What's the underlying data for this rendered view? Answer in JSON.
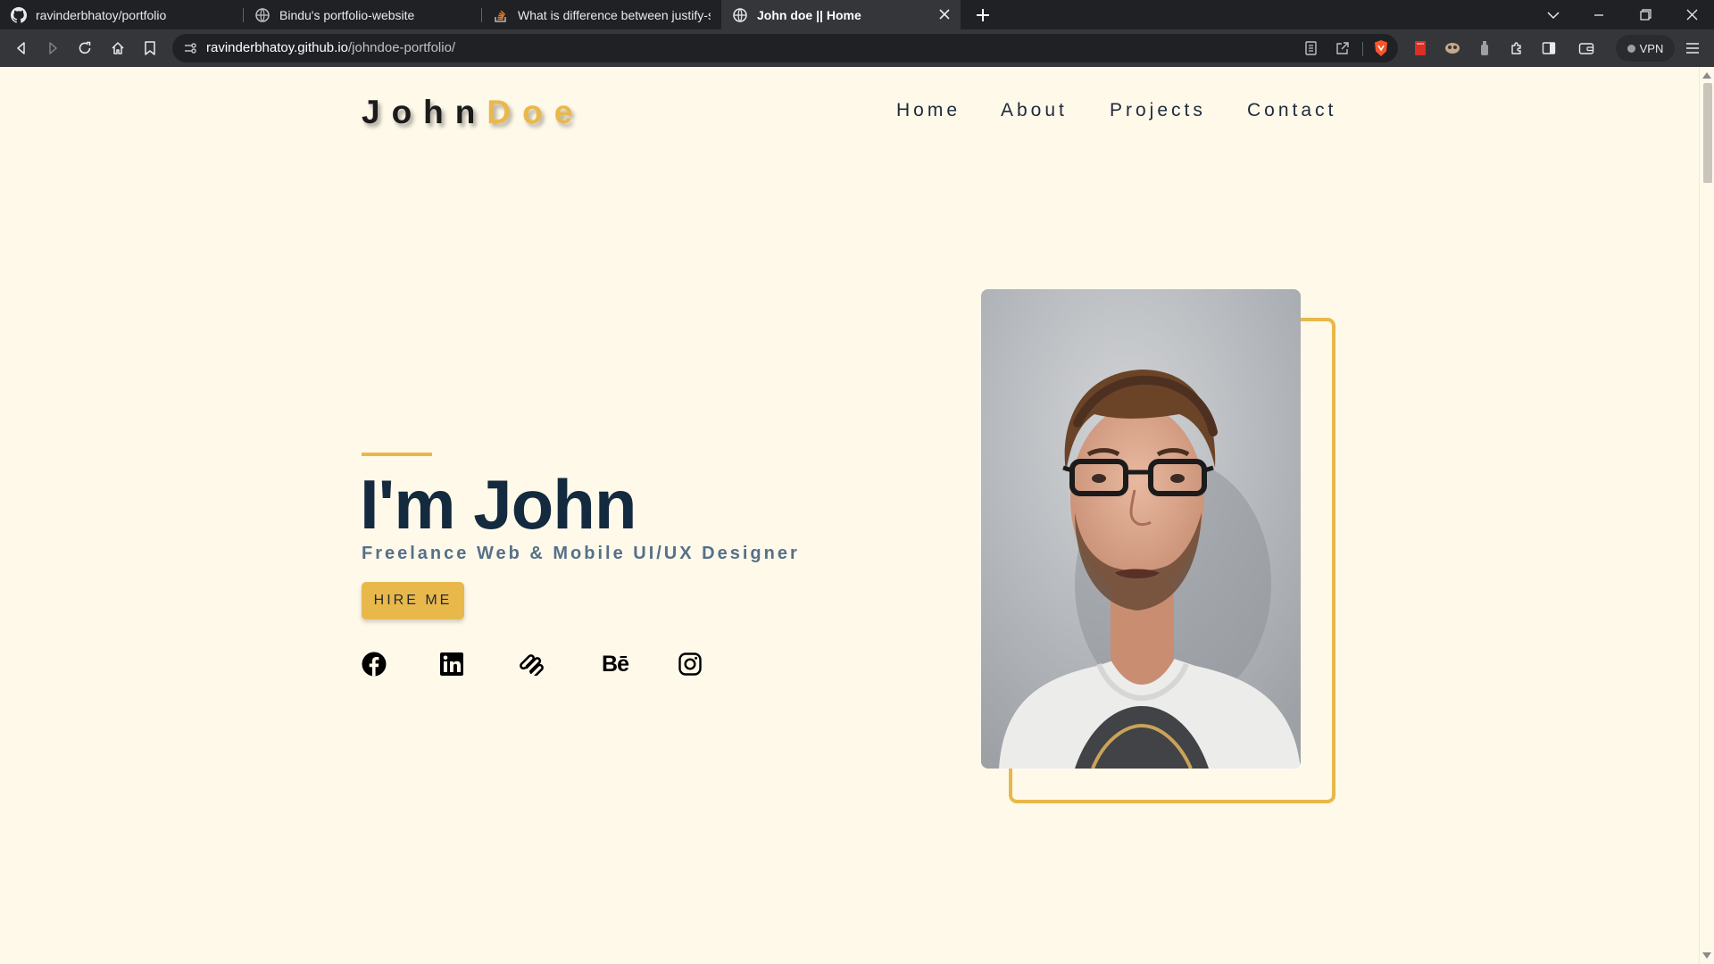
{
  "browser": {
    "tabs": [
      {
        "title": "ravinderbhatoy/portfolio",
        "icon": "github-icon",
        "active": false
      },
      {
        "title": "Bindu's portfolio-website",
        "icon": "globe-icon",
        "active": false
      },
      {
        "title": "What is difference between justify-self",
        "icon": "stackoverflow-icon",
        "active": false
      },
      {
        "title": "John doe || Home",
        "icon": "globe-icon",
        "active": true
      }
    ],
    "url_host": "ravinderbhatoy.github.io",
    "url_path": "/johndoe-portfolio/",
    "vpn_label": "VPN"
  },
  "site": {
    "logo_first": "John",
    "logo_last": "Doe",
    "nav": [
      "Home",
      "About",
      "Projects",
      "Contact"
    ],
    "hero": {
      "title": "I'm John",
      "subtitle": "Freelance Web & Mobile UI/UX Designer",
      "cta": "HIRE ME"
    },
    "social": [
      "facebook-icon",
      "linkedin-icon",
      "squarespace-icon",
      "behance-icon",
      "instagram-icon"
    ],
    "behance_text": "Bē"
  },
  "colors": {
    "accent": "#e8b84b",
    "background": "#fff9ea",
    "heading": "#142a3e",
    "subtitle": "#557089"
  }
}
